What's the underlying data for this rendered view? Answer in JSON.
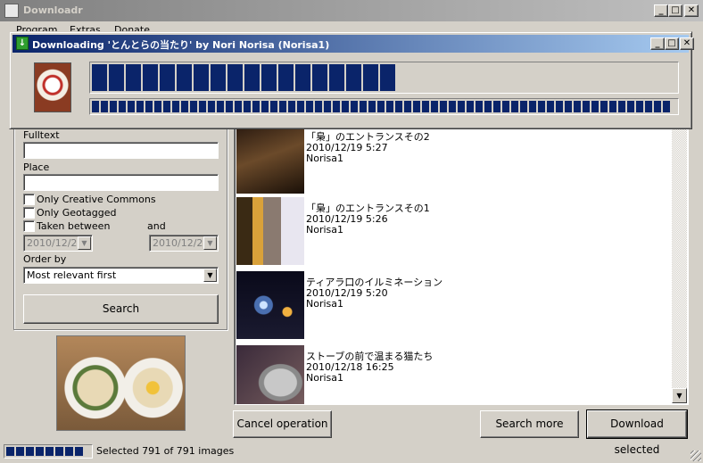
{
  "main_window": {
    "title": "Downloadr",
    "controls": {
      "minimize": "_",
      "maximize": "□",
      "close": "✕"
    }
  },
  "menu": {
    "items": [
      "Program",
      "Extras",
      "Donate"
    ]
  },
  "download_dialog": {
    "title": "Downloading 'とんとらの当たり' by Nori Norisa (Norisa1)",
    "controls": {
      "minimize": "_",
      "maximize": "□",
      "close": "✕"
    },
    "current_progress": 0.53,
    "overall_progress": 1.0
  },
  "search": {
    "fulltext_label": "Fulltext",
    "fulltext_value": "",
    "place_label": "Place",
    "place_value": "",
    "only_cc_label": "Only Creative Commons",
    "only_geotagged_label": "Only Geotagged",
    "taken_between_label": "Taken between",
    "and_label": "and",
    "date_from": "2010/12/2",
    "date_to": "2010/12/2",
    "order_by_label": "Order by",
    "order_by_value": "Most relevant first",
    "search_button": "Search"
  },
  "results": {
    "items": [
      {
        "title": "「梟」のエントランスその2",
        "date": "2010/12/19 5:27",
        "owner": "Norisa1"
      },
      {
        "title": "「梟」のエントランスその1",
        "date": "2010/12/19 5:26",
        "owner": "Norisa1"
      },
      {
        "title": "ティアラ口のイルミネーション",
        "date": "2010/12/19 5:20",
        "owner": "Norisa1"
      },
      {
        "title": "ストーブの前で温まる猫たち",
        "date": "2010/12/18 16:25",
        "owner": "Norisa1"
      }
    ]
  },
  "actions": {
    "cancel": "Cancel operation",
    "search_more": "Search more",
    "download_selected": "Download selected"
  },
  "status": {
    "progress": 1.0,
    "text": "Selected 791 of 791 images"
  }
}
